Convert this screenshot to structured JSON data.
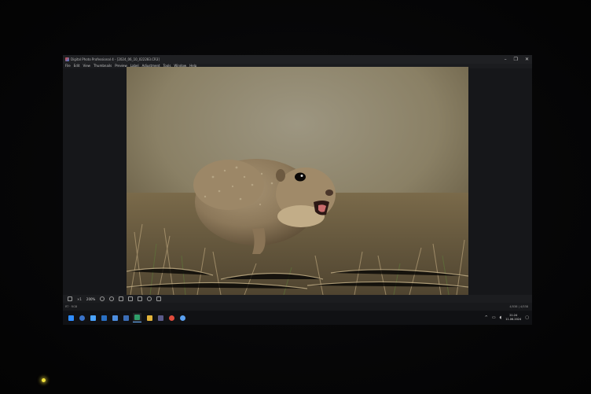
{
  "window": {
    "title": "Digital Photo Professional 4 - [2024_06_10_022283.CR3]",
    "controls": [
      "–",
      "❒",
      "✕"
    ]
  },
  "menu": [
    "File",
    "Edit",
    "View",
    "Thumbnails",
    "Preview",
    "Label",
    "Adjustment",
    "Tools",
    "Window",
    "Help"
  ],
  "toolbar": {
    "zoom_prefix": "×1",
    "zoom_value": "200%",
    "buttons": [
      "fit-icon",
      "zoom-out-icon",
      "zoom-in-icon",
      "crop-icon",
      "grid-icon",
      "compare-icon",
      "settings-icon",
      "panel-icon"
    ]
  },
  "status": {
    "left": "RT ·  RGB",
    "count": "4/538 | 4/538"
  },
  "taskbar": {
    "icons": [
      "start-icon",
      "search-icon",
      "task-view-icon",
      "edge-icon",
      "mail-icon",
      "store-icon",
      "photo-pro-icon",
      "explorer-icon",
      "app-icon",
      "chrome-icon",
      "cloud-icon"
    ],
    "time": "21:24",
    "date": "11.06.2024"
  },
  "colors": {
    "screen_bg": "#17181b",
    "accent": "#6ab0ff",
    "led": "#f2e23a"
  }
}
